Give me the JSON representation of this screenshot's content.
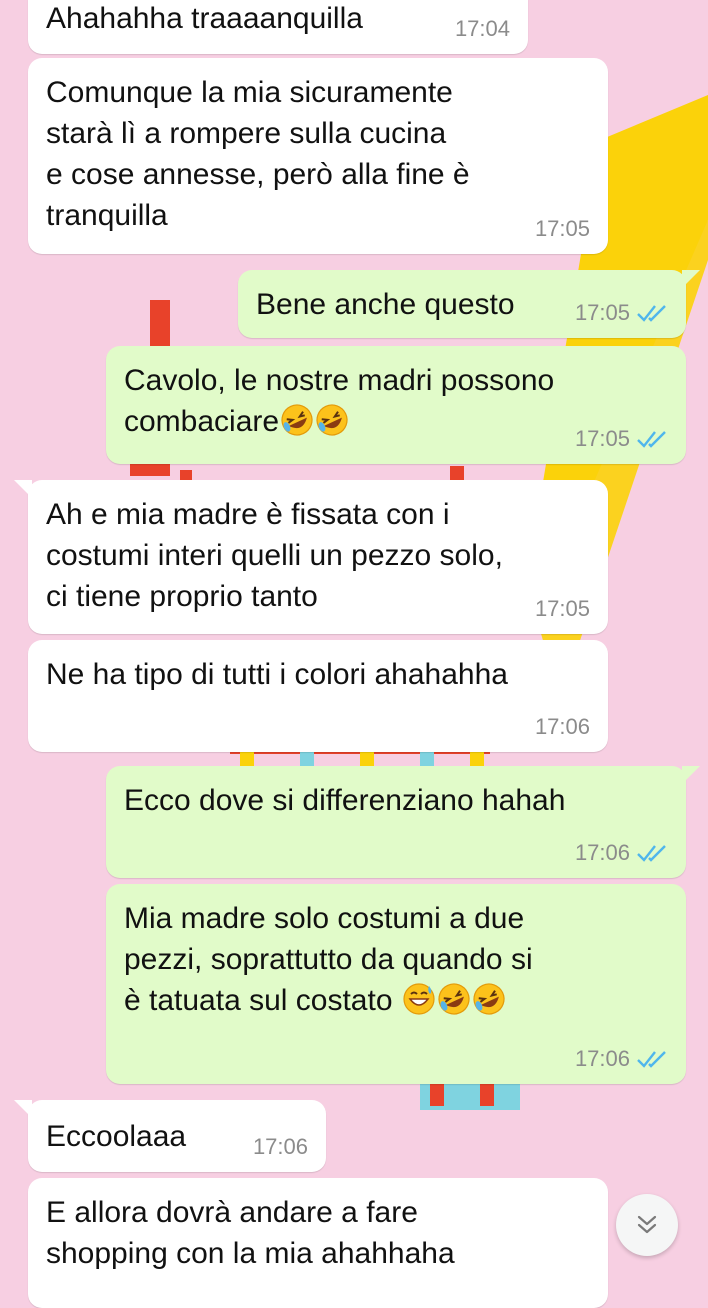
{
  "messages": [
    {
      "type": "in",
      "text": "Ahahahha traaaanquilla",
      "time": "17:04"
    },
    {
      "type": "in",
      "text": "Comunque la mia sicuramente\nstarà lì a rompere sulla cucina\ne cose annesse, però alla fine è\ntranquilla",
      "time": "17:05"
    },
    {
      "type": "out",
      "text": "Bene anche questo",
      "time": "17:05",
      "status": "read"
    },
    {
      "type": "out",
      "text": "Cavolo, le nostre madri possono\ncombaciare",
      "emoji": [
        "rolling-on-floor-laughing",
        "rolling-on-floor-laughing"
      ],
      "time": "17:05",
      "status": "read"
    },
    {
      "type": "in",
      "text": "Ah e mia madre è fissata con i\ncostumi interi quelli un pezzo solo,\nci tiene proprio tanto",
      "time": "17:05"
    },
    {
      "type": "in",
      "text": "Ne ha tipo di tutti i colori ahahahha",
      "time": "17:06"
    },
    {
      "type": "out",
      "text": "Ecco dove si differenziano hahah",
      "time": "17:06",
      "status": "read"
    },
    {
      "type": "out",
      "text": "Mia madre solo costumi a due\npezzi, soprattutto da quando si\nè tatuata sul costato ",
      "emoji": [
        "grinning-sweat",
        "rolling-on-floor-laughing",
        "rolling-on-floor-laughing"
      ],
      "time": "17:06",
      "status": "read"
    },
    {
      "type": "in",
      "text": "Eccoolaaa",
      "time": "17:06"
    },
    {
      "type": "in",
      "text": "E allora dovrà andare a fare\nshopping con la mia ahahhaha",
      "time": ""
    }
  ],
  "colors": {
    "background": "#f7cfe2",
    "incoming_bubble": "#ffffff",
    "outgoing_bubble": "#e1fbc9",
    "read_ticks": "#4fb6ec",
    "timestamp": "#8b8b8b"
  },
  "scroll_button": {
    "icon": "double-chevron-down-icon"
  }
}
